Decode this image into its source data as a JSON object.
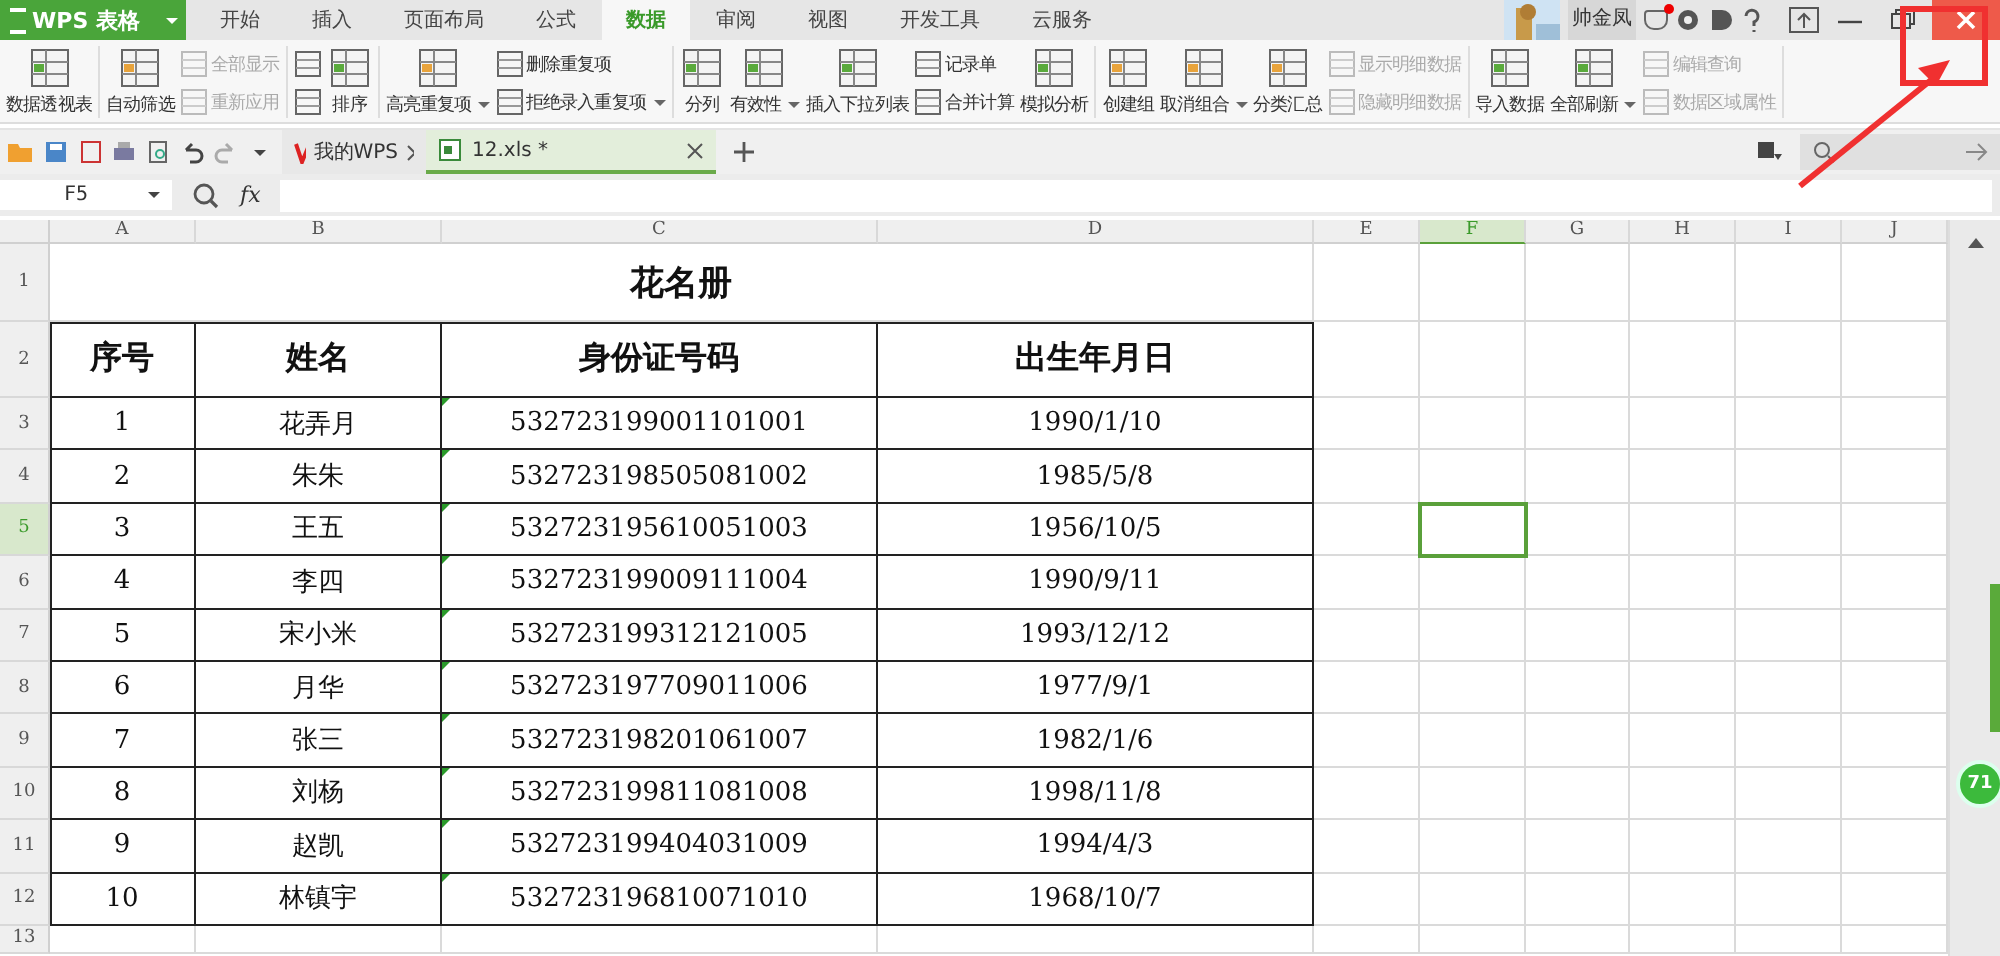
{
  "app_button": {
    "label": "WPS 表格"
  },
  "tabs": [
    {
      "label": "开始",
      "selected": false
    },
    {
      "label": "插入",
      "selected": false
    },
    {
      "label": "页面布局",
      "selected": false
    },
    {
      "label": "公式",
      "selected": false
    },
    {
      "label": "数据",
      "selected": true
    },
    {
      "label": "审阅",
      "selected": false
    },
    {
      "label": "视图",
      "selected": false
    },
    {
      "label": "开发工具",
      "selected": false
    },
    {
      "label": "云服务",
      "selected": false
    }
  ],
  "user": {
    "name": "帅金凤",
    "notification": true
  },
  "ribbon_groups": [
    {
      "items": [
        {
          "kind": "large",
          "label": "数据透视表",
          "disabled": false,
          "dropdown": false
        }
      ]
    },
    {
      "items": [
        {
          "kind": "large",
          "label": "自动筛选",
          "disabled": false,
          "dropdown": false
        },
        {
          "kind": "stack",
          "children": [
            {
              "label": "全部显示",
              "disabled": true,
              "dropdown": false
            },
            {
              "label": "重新应用",
              "disabled": true,
              "dropdown": false
            }
          ]
        }
      ]
    },
    {
      "items": [
        {
          "kind": "stack",
          "children": [
            {
              "disabled": false
            },
            {
              "disabled": false
            }
          ]
        },
        {
          "kind": "large",
          "label": "排序",
          "disabled": false,
          "dropdown": false
        }
      ]
    },
    {
      "items": [
        {
          "kind": "large",
          "label": "高亮重复项",
          "disabled": false,
          "dropdown": true
        },
        {
          "kind": "stack",
          "children": [
            {
              "label": "删除重复项",
              "disabled": false,
              "dropdown": false
            },
            {
              "label": "拒绝录入重复项",
              "disabled": false,
              "dropdown": true
            }
          ]
        }
      ]
    },
    {
      "items": [
        {
          "kind": "large",
          "label": "分列",
          "disabled": false,
          "dropdown": false
        },
        {
          "kind": "large",
          "label": "有效性",
          "disabled": false,
          "dropdown": true
        },
        {
          "kind": "large",
          "label": "插入下拉列表",
          "disabled": false,
          "dropdown": false
        },
        {
          "kind": "stack",
          "children": [
            {
              "label": "记录单",
              "disabled": false,
              "dropdown": false
            },
            {
              "label": "合并计算",
              "disabled": false,
              "dropdown": false
            }
          ]
        },
        {
          "kind": "large",
          "label": "模拟分析",
          "disabled": false,
          "dropdown": false
        }
      ]
    },
    {
      "items": [
        {
          "kind": "large",
          "label": "创建组",
          "disabled": false,
          "dropdown": false
        },
        {
          "kind": "large",
          "label": "取消组合",
          "disabled": false,
          "dropdown": true
        },
        {
          "kind": "large",
          "label": "分类汇总",
          "disabled": false,
          "dropdown": false
        },
        {
          "kind": "stack",
          "children": [
            {
              "label": "显示明细数据",
              "disabled": true,
              "dropdown": false
            },
            {
              "label": "隐藏明细数据",
              "disabled": true,
              "dropdown": false
            }
          ]
        }
      ]
    },
    {
      "items": [
        {
          "kind": "large",
          "label": "导入数据",
          "disabled": false,
          "dropdown": false
        },
        {
          "kind": "large",
          "label": "全部刷新",
          "disabled": false,
          "dropdown": true
        },
        {
          "kind": "stack",
          "children": [
            {
              "label": "编辑查询",
              "disabled": true,
              "dropdown": false
            },
            {
              "label": "数据区域属性",
              "disabled": true,
              "dropdown": false
            }
          ]
        }
      ]
    }
  ],
  "doc_tabs": [
    {
      "label": "我的WPS",
      "selected": false
    },
    {
      "label": "12.xls *",
      "selected": true
    }
  ],
  "name_box": "F5",
  "fx_label": "fx",
  "columns": [
    {
      "label": "A",
      "selected": false
    },
    {
      "label": "B",
      "selected": false
    },
    {
      "label": "C",
      "selected": false
    },
    {
      "label": "D",
      "selected": false
    },
    {
      "label": "E",
      "selected": false
    },
    {
      "label": "F",
      "selected": true
    },
    {
      "label": "G",
      "selected": false
    },
    {
      "label": "H",
      "selected": false
    },
    {
      "label": "I",
      "selected": false
    },
    {
      "label": "J",
      "selected": false
    }
  ],
  "title": {
    "row": "1",
    "text": "花名册"
  },
  "header": {
    "row": "2",
    "cells": [
      "序号",
      "姓名",
      "身份证号码",
      "出生年月日"
    ]
  },
  "records": [
    {
      "row": "3",
      "selected": false,
      "cells": [
        "1",
        "花弄月",
        "532723199001101001",
        "1990/1/10"
      ]
    },
    {
      "row": "4",
      "selected": false,
      "cells": [
        "2",
        "朱朱",
        "532723198505081002",
        "1985/5/8"
      ]
    },
    {
      "row": "5",
      "selected": true,
      "cells": [
        "3",
        "王五",
        "532723195610051003",
        "1956/10/5"
      ]
    },
    {
      "row": "6",
      "selected": false,
      "cells": [
        "4",
        "李四",
        "532723199009111004",
        "1990/9/11"
      ]
    },
    {
      "row": "7",
      "selected": false,
      "cells": [
        "5",
        "宋小米",
        "532723199312121005",
        "1993/12/12"
      ]
    },
    {
      "row": "8",
      "selected": false,
      "cells": [
        "6",
        "月华",
        "532723197709011006",
        "1977/9/1"
      ]
    },
    {
      "row": "9",
      "selected": false,
      "cells": [
        "7",
        "张三",
        "532723198201061007",
        "1982/1/6"
      ]
    },
    {
      "row": "10",
      "selected": false,
      "cells": [
        "8",
        "刘杨",
        "532723199811081008",
        "1998/11/8"
      ]
    },
    {
      "row": "11",
      "selected": false,
      "cells": [
        "9",
        "赵凯",
        "532723199404031009",
        "1994/4/3"
      ]
    },
    {
      "row": "12",
      "selected": false,
      "cells": [
        "10",
        "林镇宇",
        "532723196810071010",
        "1968/10/7"
      ]
    }
  ],
  "next_row": "13",
  "floating_badge": "71"
}
